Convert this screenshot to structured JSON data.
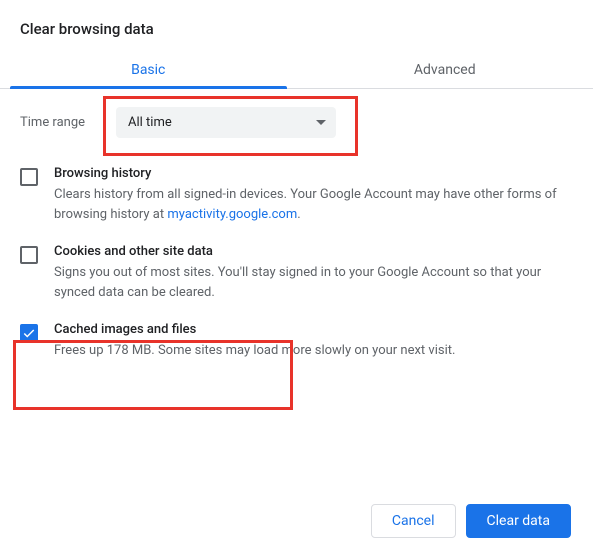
{
  "title": "Clear browsing data",
  "tabs": {
    "basic": "Basic",
    "advanced": "Advanced"
  },
  "time": {
    "label": "Time range",
    "selected": "All time"
  },
  "options": {
    "history": {
      "title": "Browsing history",
      "desc_pre": "Clears history from all signed-in devices. Your Google Account may have other forms of browsing history at ",
      "link": "myactivity.google.com",
      "desc_post": "."
    },
    "cookies": {
      "title": "Cookies and other site data",
      "desc": "Signs you out of most sites. You'll stay signed in to your Google Account so that your synced data can be cleared."
    },
    "cached": {
      "title": "Cached images and files",
      "desc": "Frees up 178 MB. Some sites may load more slowly on your next visit."
    }
  },
  "buttons": {
    "cancel": "Cancel",
    "clear": "Clear data"
  }
}
